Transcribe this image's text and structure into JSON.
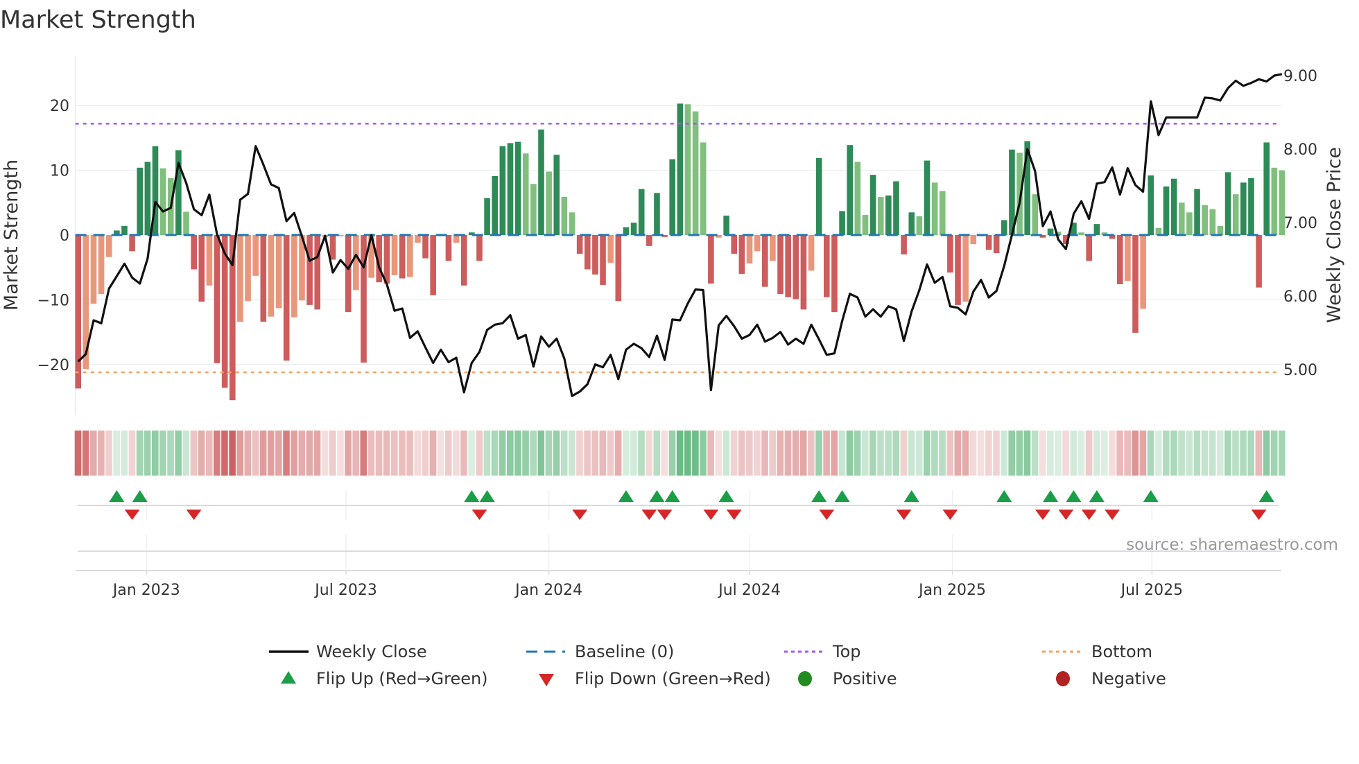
{
  "title": "Market Strength",
  "source_label": "source: sharemaestro.com",
  "colors": {
    "pos_dark": "#2e8b57",
    "pos_light": "#80bf7e",
    "neg_dark": "#cd5c5c",
    "neg_light": "#e9967a",
    "price_line": "#111111",
    "baseline": "#1f77b4",
    "top": "#a259f0",
    "bottom": "#f4a261",
    "flip_up": "#1a9e47",
    "flip_down": "#d62728",
    "positive": "#228b22",
    "negative": "#b22222"
  },
  "legend": [
    {
      "key": "weekly_close",
      "label": "Weekly Close"
    },
    {
      "key": "baseline",
      "label": "Baseline (0)"
    },
    {
      "key": "top",
      "label": "Top"
    },
    {
      "key": "bottom",
      "label": "Bottom"
    },
    {
      "key": "flip_up",
      "label": "Flip Up (Red→Green)"
    },
    {
      "key": "flip_down",
      "label": "Flip Down (Green→Red)"
    },
    {
      "key": "positive",
      "label": "Positive"
    },
    {
      "key": "negative",
      "label": "Negative"
    }
  ],
  "chart_data": {
    "type": "bar",
    "title": "Market Strength",
    "ylabel": "Market Strength",
    "y2label": "Weekly Close Price",
    "frequency": "weekly",
    "start_date": "2022-10-31",
    "ylim": [
      -27,
      27
    ],
    "y2lim": [
      4.5,
      9.2
    ],
    "yticks": [
      {
        "v": 20,
        "label": "20"
      },
      {
        "v": 10,
        "label": "10"
      },
      {
        "v": 0,
        "label": "0"
      },
      {
        "v": -10,
        "label": "−10"
      },
      {
        "v": -20,
        "label": "−20"
      }
    ],
    "y2ticks": [
      {
        "v": 9,
        "label": "9.00"
      },
      {
        "v": 8,
        "label": "8.00"
      },
      {
        "v": 7,
        "label": "7.00"
      },
      {
        "v": 6,
        "label": "6.00"
      },
      {
        "v": 5,
        "label": "5.00"
      }
    ],
    "xticks": [
      {
        "date": "2023-01-01",
        "label": "Jan 2023"
      },
      {
        "date": "2023-07-01",
        "label": "Jul 2023"
      },
      {
        "date": "2024-01-01",
        "label": "Jan 2024"
      },
      {
        "date": "2024-07-01",
        "label": "Jul 2024"
      },
      {
        "date": "2025-01-01",
        "label": "Jan 2025"
      },
      {
        "date": "2025-07-01",
        "label": "Jul 2025"
      }
    ],
    "top_level": 17.2,
    "bottom_level": -21.2,
    "baseline": 0,
    "grid": true,
    "legend_position": "bottom",
    "strength": [
      -23.7,
      -20.7,
      -10.6,
      -9.1,
      -3.4,
      0.7,
      1.4,
      -2.5,
      10.4,
      11.3,
      13.7,
      10.3,
      8.8,
      13.1,
      3.6,
      -5.3,
      -10.3,
      -7.8,
      -19.8,
      -23.6,
      -25.5,
      -13.4,
      -10.2,
      -6.3,
      -13.4,
      -12.6,
      -11.3,
      -19.4,
      -12.7,
      -10.1,
      -10.8,
      -11.5,
      -0.3,
      -3.8,
      -0.2,
      -11.9,
      -8.5,
      -19.7,
      -6.6,
      -7.3,
      -7.5,
      -6.2,
      -6.7,
      -6.5,
      -1.2,
      -3.6,
      -9.3,
      -0.2,
      -4.0,
      -1.2,
      -7.8,
      0.4,
      -4.0,
      5.7,
      9.1,
      13.7,
      14.2,
      14.4,
      12.6,
      7.9,
      16.3,
      9.8,
      12.4,
      5.9,
      3.5,
      -2.9,
      -5.3,
      -6.1,
      -7.7,
      -4.3,
      -10.2,
      1.2,
      1.9,
      7.1,
      -1.7,
      6.5,
      -0.3,
      11.7,
      20.3,
      20.2,
      19.1,
      14.3,
      -7.5,
      -0.4,
      3.0,
      -2.9,
      -6.0,
      -4.4,
      -2.5,
      -8.0,
      -4.0,
      -9.1,
      -9.6,
      -9.9,
      -11.5,
      -5.5,
      11.9,
      -9.6,
      -11.9,
      3.7,
      13.9,
      11.3,
      3.1,
      9.3,
      5.9,
      6.1,
      8.3,
      -3.0,
      3.5,
      2.9,
      11.5,
      8.1,
      6.8,
      -5.8,
      -10.8,
      -10.3,
      -1.4,
      -0.2,
      -2.3,
      -2.8,
      2.3,
      13.2,
      12.7,
      14.5,
      6.3,
      -0.4,
      1.0,
      0.5,
      -1.4,
      1.9,
      0.4,
      -4.0,
      1.7,
      0.4,
      -0.6,
      -7.6,
      -7.1,
      -15.1,
      -11.4,
      9.2,
      1.1,
      7.5,
      8.7,
      5.0,
      3.5,
      7.1,
      4.6,
      4.0,
      1.4,
      9.7,
      6.3,
      8.1,
      8.8,
      -8.1,
      14.3,
      10.4,
      10.0
    ],
    "weekly_close": [
      5.11,
      5.21,
      5.67,
      5.63,
      6.1,
      6.27,
      6.44,
      6.25,
      6.17,
      6.51,
      7.28,
      7.15,
      7.2,
      7.81,
      7.54,
      7.18,
      7.1,
      7.38,
      6.84,
      6.58,
      6.42,
      7.31,
      7.39,
      8.04,
      7.79,
      7.52,
      7.47,
      7.02,
      7.13,
      6.81,
      6.48,
      6.53,
      6.82,
      6.32,
      6.49,
      6.37,
      6.56,
      6.39,
      6.83,
      6.39,
      6.16,
      5.8,
      5.83,
      5.43,
      5.52,
      5.3,
      5.09,
      5.27,
      5.1,
      5.16,
      4.69,
      5.09,
      5.24,
      5.54,
      5.61,
      5.63,
      5.74,
      5.42,
      5.47,
      5.04,
      5.45,
      5.31,
      5.42,
      5.15,
      4.64,
      4.7,
      4.8,
      5.07,
      5.03,
      5.2,
      4.87,
      5.27,
      5.35,
      5.29,
      5.17,
      5.46,
      5.13,
      5.68,
      5.67,
      5.9,
      6.09,
      6.08,
      4.72,
      5.6,
      5.73,
      5.59,
      5.42,
      5.47,
      5.61,
      5.38,
      5.43,
      5.51,
      5.34,
      5.42,
      5.35,
      5.61,
      5.41,
      5.2,
      5.22,
      5.66,
      6.03,
      5.98,
      5.72,
      5.82,
      5.72,
      5.86,
      5.82,
      5.39,
      5.79,
      6.08,
      6.43,
      6.18,
      6.26,
      5.86,
      5.84,
      5.75,
      6.06,
      6.22,
      5.98,
      6.07,
      6.41,
      6.83,
      7.27,
      8.0,
      7.7,
      6.95,
      7.15,
      6.77,
      6.64,
      7.12,
      7.29,
      7.05,
      7.53,
      7.55,
      7.75,
      7.38,
      7.74,
      7.51,
      7.42,
      8.65,
      8.19,
      8.43,
      8.43,
      8.43,
      8.43,
      8.43,
      8.7,
      8.69,
      8.66,
      8.83,
      8.93,
      8.86,
      8.9,
      8.95,
      8.92,
      9.0,
      9.02
    ],
    "flip_up_weeks": [
      6,
      9,
      52,
      54,
      72,
      76,
      78,
      85,
      97,
      100,
      109,
      121,
      127,
      130,
      133,
      140,
      155
    ],
    "flip_down_weeks": [
      8,
      16,
      53,
      66,
      75,
      77,
      83,
      86,
      98,
      108,
      114,
      126,
      129,
      132,
      135,
      154
    ]
  }
}
